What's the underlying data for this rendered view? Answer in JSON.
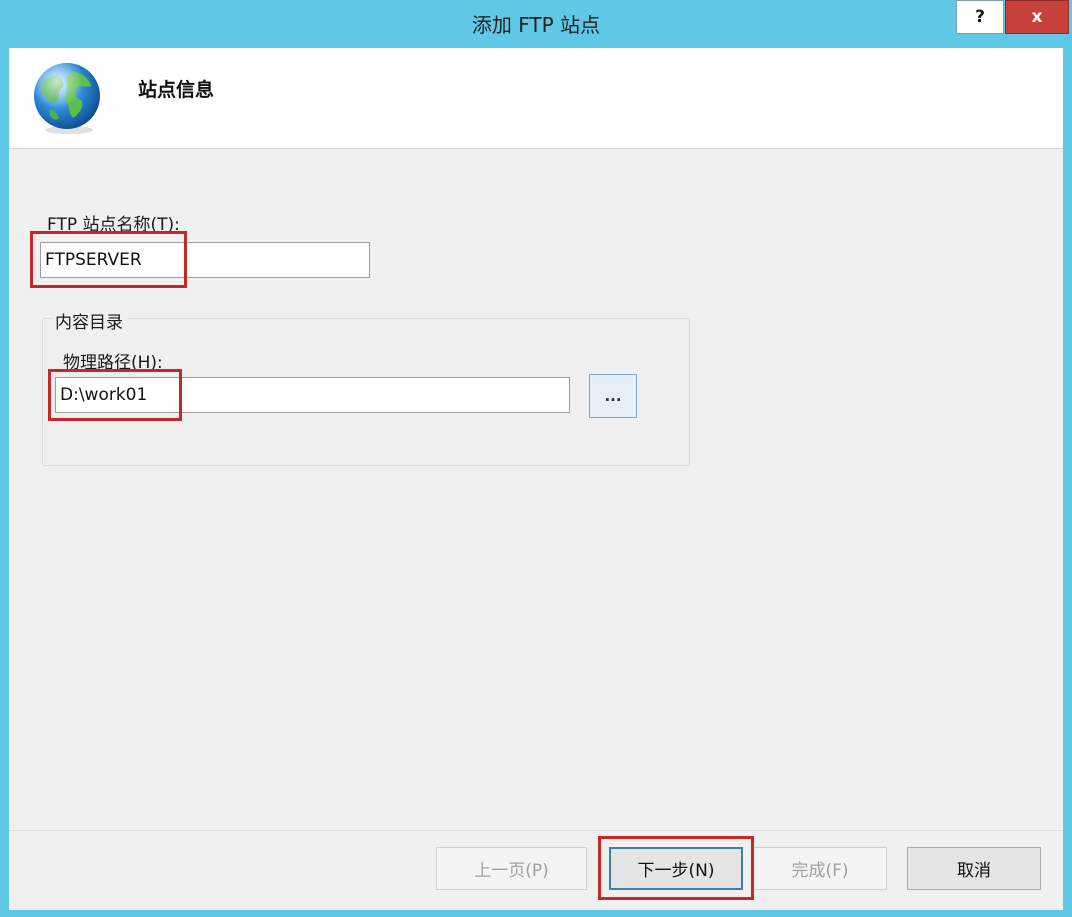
{
  "window": {
    "title": "添加 FTP 站点",
    "help_label": "?",
    "close_label": "x"
  },
  "header": {
    "title": "站点信息",
    "icon": "globe-icon"
  },
  "form": {
    "site_name_label": "FTP 站点名称(T):",
    "site_name_value": "FTPSERVER",
    "content_directory_label": "内容目录",
    "physical_path_label": "物理路径(H):",
    "physical_path_value": "D:\\work01",
    "browse_label": "..."
  },
  "footer": {
    "previous_label": "上一页(P)",
    "next_label": "下一步(N)",
    "finish_label": "完成(F)",
    "cancel_label": "取消"
  },
  "colors": {
    "titlebar": "#5fc8e6",
    "close_button": "#c7413a",
    "highlight": "#c62828",
    "client_background": "#f0f0f0"
  }
}
